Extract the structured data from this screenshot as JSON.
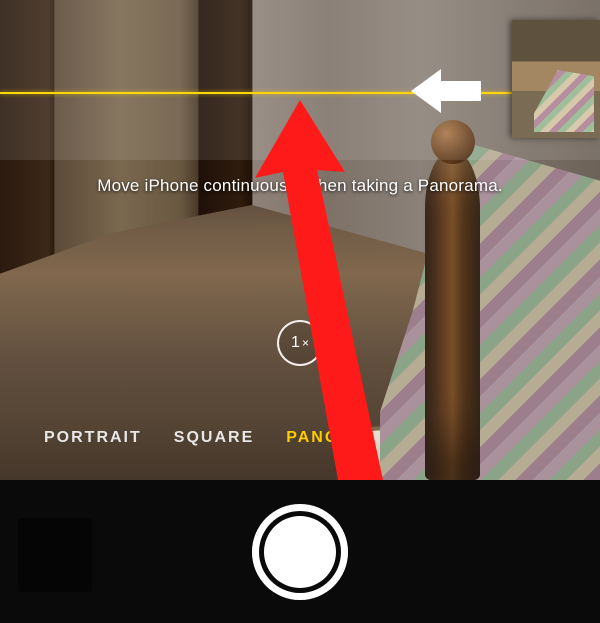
{
  "instruction_text": "Move iPhone continuously when taking a Panorama.",
  "zoom": {
    "value": "1",
    "suffix": "×"
  },
  "modes": {
    "items": [
      {
        "label": "PORTRAIT",
        "active": false
      },
      {
        "label": "SQUARE",
        "active": false
      },
      {
        "label": "PANO",
        "active": true
      }
    ]
  },
  "colors": {
    "accent_yellow": "#ffcc00",
    "guideline_yellow": "#ffd60a",
    "annotation_red": "#ff1a1a"
  },
  "icons": {
    "direction_arrow": "arrow-left-icon",
    "annotation_arrow": "arrow-up-icon"
  }
}
